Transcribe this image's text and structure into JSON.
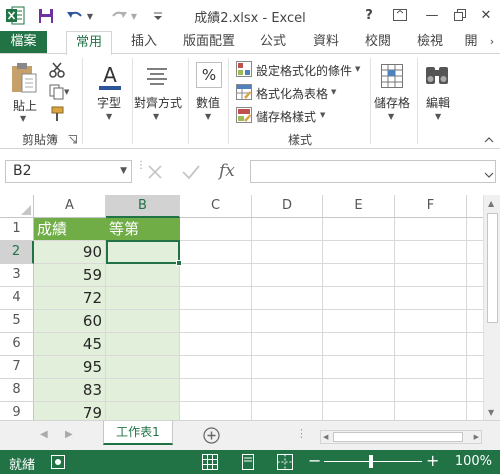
{
  "window": {
    "title": "成績2.xlsx - Excel",
    "help_label": "?",
    "minimize_label": "—",
    "close_label": "✕"
  },
  "tabs": [
    {
      "label": "檔案"
    },
    {
      "label": "常用"
    },
    {
      "label": "插入"
    },
    {
      "label": "版面配置"
    },
    {
      "label": "公式"
    },
    {
      "label": "資料"
    },
    {
      "label": "校閱"
    },
    {
      "label": "檢視"
    },
    {
      "label": "開"
    }
  ],
  "ribbon": {
    "paste_label": "貼上",
    "clipboard_group": "剪貼簿",
    "font_label": "字型",
    "align_label": "對齊方式",
    "number_label": "數值",
    "percent_symbol": "%",
    "font_symbol": "A",
    "cond_format_label": "設定格式化的條件",
    "format_table_label": "格式化為表格",
    "cell_styles_label": "儲存格樣式",
    "styles_group": "樣式",
    "cells_label": "儲存格",
    "editing_label": "編輯"
  },
  "formula_bar": {
    "name_box": "B2",
    "fx_label": "fx",
    "formula": ""
  },
  "columns": [
    "A",
    "B",
    "C",
    "D",
    "E",
    "F"
  ],
  "rows": [
    "1",
    "2",
    "3",
    "4",
    "5",
    "6",
    "7",
    "8",
    "9"
  ],
  "cells": {
    "a1": "成績",
    "b1": "等第",
    "scores": [
      "90",
      "59",
      "72",
      "60",
      "45",
      "95",
      "83",
      "79"
    ]
  },
  "sheet_tab": "工作表1",
  "status": {
    "ready": "就緒",
    "zoom": "100%"
  },
  "colors": {
    "brand": "#217346",
    "header_fill": "#70ad47",
    "data_fill": "#e2efda"
  }
}
